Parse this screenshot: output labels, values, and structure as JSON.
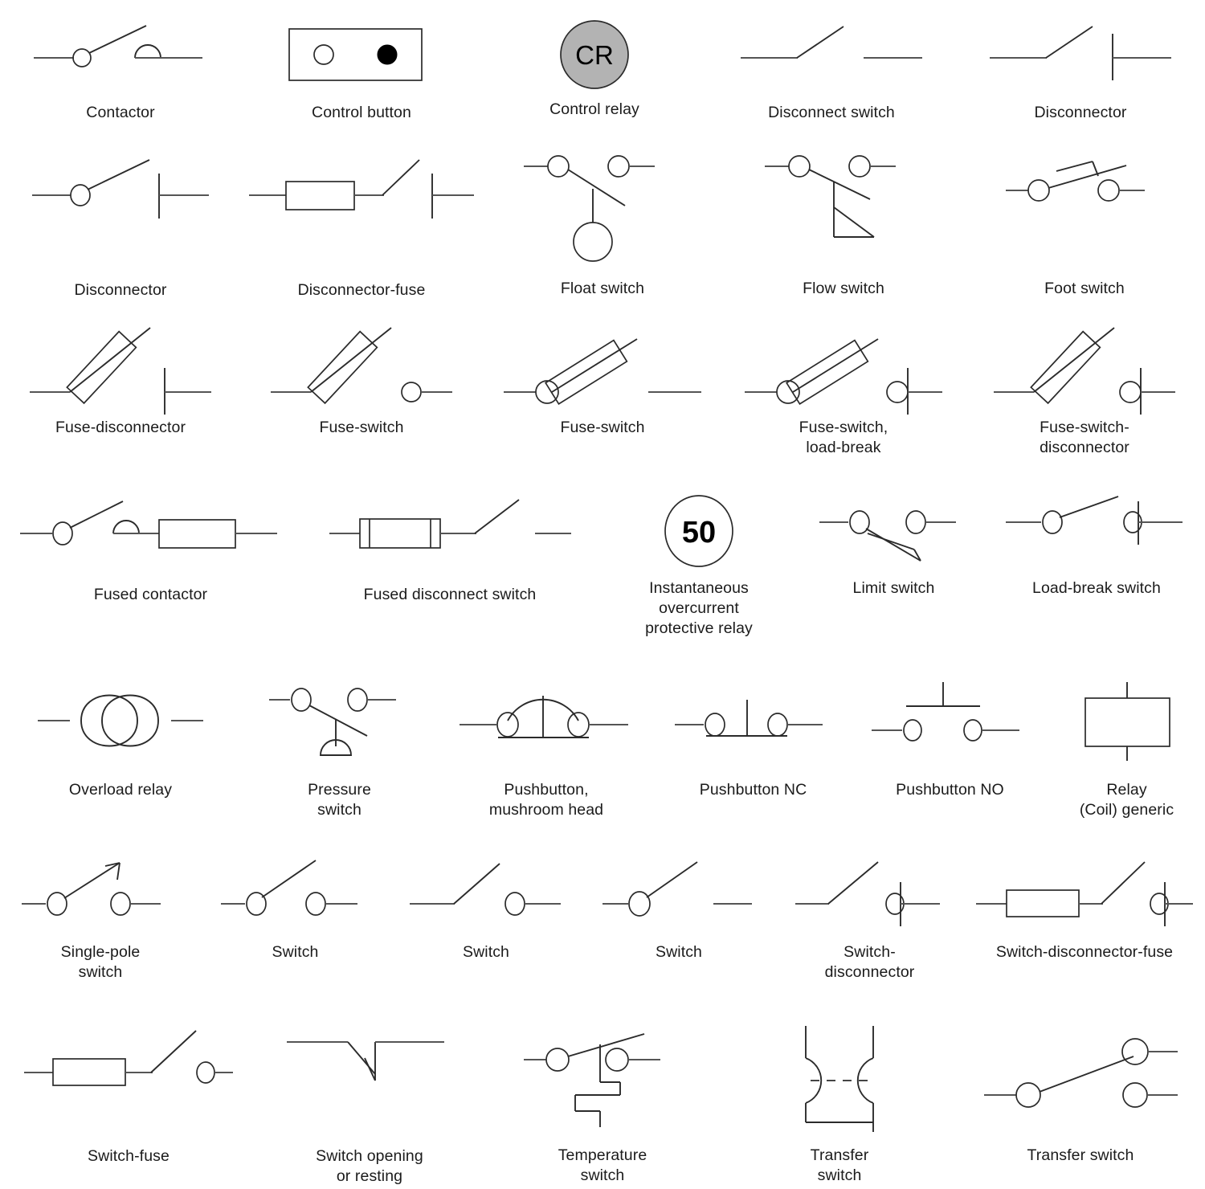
{
  "page": {
    "title": "Electrical switch and relay schematic symbols",
    "background_color": "#ffffff",
    "line_color": "#2b2b2b",
    "wire_color": "#555555",
    "fill_gray": "#b3b3b3",
    "columns_per_row": [
      5,
      5,
      5,
      5,
      6,
      6,
      5
    ],
    "symbol_count": 37
  },
  "rows": [
    {
      "index": 1,
      "cells": [
        {
          "id": "contactor",
          "label": "Contactor",
          "icon": "contactor-symbol"
        },
        {
          "id": "control-button",
          "label": "Control button",
          "icon": "control-button-symbol"
        },
        {
          "id": "control-relay",
          "label": "Control relay",
          "icon": "control-relay-symbol",
          "inner_text": "CR"
        },
        {
          "id": "disconnect-switch",
          "label": "Disconnect switch",
          "icon": "disconnect-switch-symbol"
        },
        {
          "id": "disconnector-1",
          "label": "Disconnector",
          "icon": "disconnector-symbol"
        }
      ]
    },
    {
      "index": 2,
      "cells": [
        {
          "id": "disconnector-2",
          "label": "Disconnector",
          "icon": "disconnector-circle-symbol"
        },
        {
          "id": "disconnector-fuse",
          "label": "Disconnector-fuse",
          "icon": "disconnector-fuse-symbol"
        },
        {
          "id": "float-switch",
          "label": "Float switch",
          "icon": "float-switch-symbol"
        },
        {
          "id": "flow-switch",
          "label": "Flow switch",
          "icon": "flow-switch-symbol"
        },
        {
          "id": "foot-switch",
          "label": "Foot switch",
          "icon": "foot-switch-symbol"
        }
      ]
    },
    {
      "index": 3,
      "cells": [
        {
          "id": "fuse-disconnector",
          "label": "Fuse-disconnector",
          "icon": "fuse-disconnector-symbol"
        },
        {
          "id": "fuse-switch-1",
          "label": "Fuse-switch",
          "icon": "fuse-switch-symbol"
        },
        {
          "id": "fuse-switch-2",
          "label": "Fuse-switch",
          "icon": "fuse-switch-alt-symbol"
        },
        {
          "id": "fuse-switch-load-break",
          "label": "Fuse-switch,\nload-break",
          "icon": "fuse-switch-load-break-symbol"
        },
        {
          "id": "fuse-switch-disconnector",
          "label": "Fuse-switch-\ndisconnector",
          "icon": "fuse-switch-disconnector-symbol"
        }
      ]
    },
    {
      "index": 4,
      "cells": [
        {
          "id": "fused-contactor",
          "label": "Fused contactor",
          "icon": "fused-contactor-symbol"
        },
        {
          "id": "fused-disconnect-switch",
          "label": "Fused disconnect switch",
          "icon": "fused-disconnect-switch-symbol"
        },
        {
          "id": "instantaneous-overcurrent-protective-relay",
          "label": "Instantaneous\novercurrent\nprotective relay",
          "icon": "overcurrent-relay-symbol",
          "inner_text": "50"
        },
        {
          "id": "limit-switch",
          "label": "Limit switch",
          "icon": "limit-switch-symbol"
        },
        {
          "id": "load-break-switch",
          "label": "Load-break switch",
          "icon": "load-break-switch-symbol"
        }
      ]
    },
    {
      "index": 5,
      "cells": [
        {
          "id": "overload-relay",
          "label": "Overload relay",
          "icon": "overload-relay-symbol"
        },
        {
          "id": "pressure-switch",
          "label": "Pressure\nswitch",
          "icon": "pressure-switch-symbol"
        },
        {
          "id": "pushbutton-mushroom-head",
          "label": "Pushbutton,\nmushroom head",
          "icon": "pushbutton-mushroom-symbol"
        },
        {
          "id": "pushbutton-nc",
          "label": "Pushbutton NC",
          "icon": "pushbutton-nc-symbol"
        },
        {
          "id": "pushbutton-no",
          "label": "Pushbutton NO",
          "icon": "pushbutton-no-symbol"
        },
        {
          "id": "relay-coil-generic",
          "label": "Relay\n(Coil) generic",
          "icon": "relay-coil-symbol"
        }
      ]
    },
    {
      "index": 6,
      "cells": [
        {
          "id": "single-pole-switch",
          "label": "Single-pole\nswitch",
          "icon": "single-pole-switch-symbol"
        },
        {
          "id": "switch-1",
          "label": "Switch",
          "icon": "switch-circle-symbol"
        },
        {
          "id": "switch-2",
          "label": "Switch",
          "icon": "switch-plain-symbol"
        },
        {
          "id": "switch-3",
          "label": "Switch",
          "icon": "switch-open-symbol"
        },
        {
          "id": "switch-disconnector",
          "label": "Switch-\ndisconnector",
          "icon": "switch-disconnector-symbol"
        },
        {
          "id": "switch-disconnector-fuse",
          "label": "Switch-disconnector-fuse",
          "icon": "switch-disconnector-fuse-symbol"
        }
      ]
    },
    {
      "index": 7,
      "cells": [
        {
          "id": "switch-fuse",
          "label": "Switch-fuse",
          "icon": "switch-fuse-symbol"
        },
        {
          "id": "switch-opening-or-resting",
          "label": "Switch opening\nor resting",
          "icon": "switch-opening-symbol"
        },
        {
          "id": "temperature-switch",
          "label": "Temperature\nswitch",
          "icon": "temperature-switch-symbol"
        },
        {
          "id": "transfer-switch-1",
          "label": "Transfer\nswitch",
          "icon": "transfer-switch-bracket-symbol"
        },
        {
          "id": "transfer-switch-2",
          "label": "Transfer switch",
          "icon": "transfer-switch-symbol"
        }
      ]
    }
  ]
}
